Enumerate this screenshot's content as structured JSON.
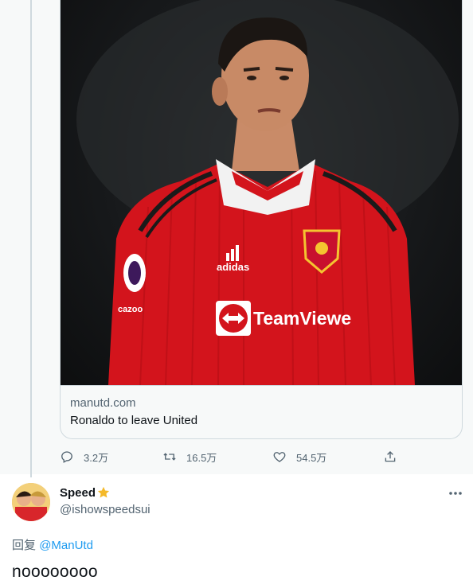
{
  "parent": {
    "card": {
      "domain": "manutd.com",
      "title": "Ronaldo to leave United",
      "image_alt": "Cristiano Ronaldo in a red Manchester United jersey"
    },
    "jersey": {
      "sponsor_text": "TeamViewe",
      "brand_text": "adidas",
      "sleeve_text": "cazoo"
    },
    "actions": {
      "replies": "3.2万",
      "retweets": "16.5万",
      "likes": "54.5万"
    }
  },
  "reply": {
    "display_name": "Speed",
    "handle": "@ishowspeedsui",
    "reply_prefix": "回复",
    "reply_mention": "@ManUtd",
    "text": "noooooooo"
  },
  "colors": {
    "accent": "#1d9bf0",
    "muted": "#536471",
    "text": "#0f1419",
    "jersey_red": "#d3141c"
  }
}
